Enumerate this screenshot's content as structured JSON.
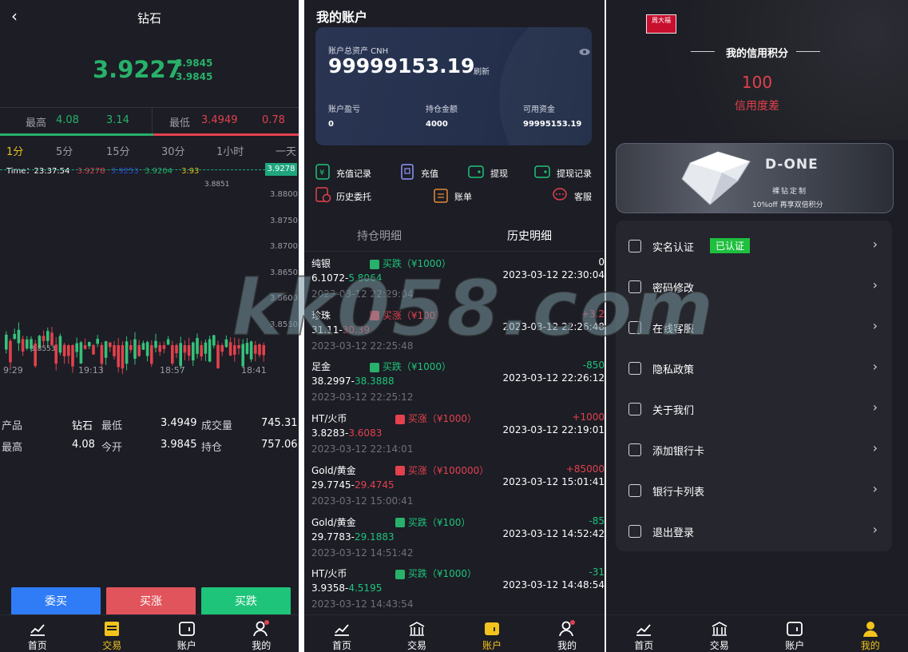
{
  "panel1": {
    "title": "钻石",
    "price": "3.9227",
    "price_hi": "3.9845",
    "price_lo": "3.9845",
    "high_label": "最高",
    "high_value": "4.08",
    "high_value2": "3.14",
    "low_label": "最低",
    "low_value": "3.4949",
    "low_value2": "0.78",
    "periods": [
      "1分",
      "5分",
      "15分",
      "30分",
      "1小时",
      "一天"
    ],
    "time_label": "Time：",
    "time_value": "23:37:54",
    "t_v1": "3.9278",
    "t_v2": "3.9204",
    "t_v3": "3.93",
    "price_tag": "3.9278",
    "y_ticks": [
      "3.8851",
      "3.8800",
      "3.8750",
      "3.8700",
      "3.8650",
      "3.8600",
      "3.8550"
    ],
    "y_top_tag": "3.8851",
    "y_low_tag": "3.8553",
    "x_ticks": [
      "9:29",
      "19:13",
      "18:57",
      "18:41"
    ],
    "info": {
      "product_label": "产品",
      "product_value": "钻石",
      "low_label": "最低",
      "low_value": "3.4949",
      "vol_label": "成交量",
      "vol_value": "745.31",
      "high_label": "最高",
      "high_value": "4.08",
      "open_label": "今开",
      "open_value": "3.9845",
      "pos_label": "持仓",
      "pos_value": "757.06"
    },
    "buttons": {
      "entrust": "委买",
      "up": "买涨",
      "down": "买跌"
    },
    "tabs": [
      "首页",
      "交易",
      "账户",
      "我的"
    ]
  },
  "panel2": {
    "title": "我的账户",
    "assets_label": "账户总资产 CNH",
    "assets_value": "99999153.19",
    "refresh": "刷新",
    "pnl_label": "账户盈亏",
    "pnl_value": "0",
    "hold_label": "持仓金额",
    "hold_value": "4000",
    "avail_label": "可用资金",
    "avail_value": "99995153.19",
    "actions": [
      "充值记录",
      "充值",
      "提现",
      "提现记录",
      "历史委托",
      "账单",
      "客服"
    ],
    "tab_hold": "持仓明细",
    "tab_hist": "历史明细",
    "rows": [
      {
        "name": "纯银",
        "dir": "买跌（¥1000）",
        "range_a": "6.1072",
        "range_b": "5.8064",
        "pnl": "0",
        "close": "2023-03-12 22:30:04",
        "open": "2023-03-12 22:29:04",
        "up": false
      },
      {
        "name": "珍珠",
        "dir": "买涨（¥100）",
        "range_a": "31.11",
        "range_b": "30.39",
        "pnl": "+3.2",
        "close": "2023-03-12 22:26:48",
        "open": "2023-03-12 22:25:48",
        "up": true
      },
      {
        "name": "足金",
        "dir": "买跌（¥1000）",
        "range_a": "38.2997",
        "range_b": "38.3888",
        "pnl": "-850",
        "close": "2023-03-12 22:26:12",
        "open": "2023-03-12 22:25:12",
        "up": false
      },
      {
        "name": "HT/火币",
        "dir": "买涨（¥1000）",
        "range_a": "3.8283",
        "range_b": "3.6083",
        "pnl": "+1000",
        "close": "2023-03-12 22:19:01",
        "open": "2023-03-12 22:14:01",
        "up": true
      },
      {
        "name": "Gold/黄金",
        "dir": "买涨（¥100000）",
        "range_a": "29.7745",
        "range_b": "29.4745",
        "pnl": "+85000",
        "close": "2023-03-12 15:01:41",
        "open": "2023-03-12 15:00:41",
        "up": true
      },
      {
        "name": "Gold/黄金",
        "dir": "买跌（¥100）",
        "range_a": "29.7783",
        "range_b": "29.1883",
        "pnl": "-85",
        "close": "2023-03-12 14:52:42",
        "open": "2023-03-12 14:51:42",
        "up": false
      },
      {
        "name": "HT/火币",
        "dir": "买跌（¥1000）",
        "range_a": "3.9358",
        "range_b": "4.5195",
        "pnl": "-31",
        "close": "2023-03-12 14:48:54",
        "open": "2023-03-12 14:43:54",
        "up": false
      }
    ],
    "tabs": [
      "首页",
      "交易",
      "账户",
      "我的"
    ]
  },
  "panel3": {
    "logo_text": "周大福",
    "credit_title": "我的信用积分",
    "credit_value": "100",
    "credit_level": "信用度差",
    "banner_brand": "D-ONE",
    "banner_sub": "裸钻定制",
    "banner_promo": "10%off 再享双倍积分",
    "menu": [
      {
        "label": "实名认证",
        "badge": "已认证",
        "icon": "id-card-icon"
      },
      {
        "label": "密码修改",
        "icon": "lock-icon"
      },
      {
        "label": "在线客服",
        "icon": "chat-icon"
      },
      {
        "label": "隐私政策",
        "icon": "shield-icon"
      },
      {
        "label": "关于我们",
        "icon": "info-icon"
      },
      {
        "label": "添加银行卡",
        "icon": "card-icon"
      },
      {
        "label": "银行卡列表",
        "icon": "list-icon"
      },
      {
        "label": "退出登录",
        "icon": "power-icon"
      }
    ],
    "tabs": [
      "首页",
      "交易",
      "账户",
      "我的"
    ]
  },
  "watermark": "kk058.com",
  "colors": {
    "green": "#27b16a",
    "red": "#e2414d",
    "yellow": "#f2c31c",
    "blue": "#2f7cf6",
    "bg": "#1c1d25"
  }
}
